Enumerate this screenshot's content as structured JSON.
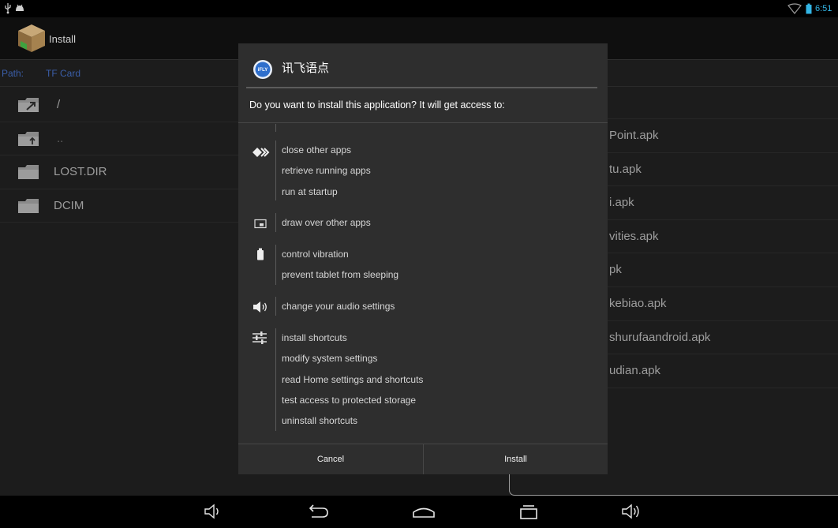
{
  "status_bar": {
    "time": "6:51",
    "left_icons": [
      "usb-icon",
      "android-debug-icon"
    ],
    "right_icons": [
      "wifi-icon",
      "battery-icon"
    ]
  },
  "app_bar": {
    "title": "Install",
    "icon": "installer-app-icon"
  },
  "path_bar": {
    "label": "Path:",
    "value": "TF Card"
  },
  "left_pane": {
    "items": [
      {
        "label": "/",
        "icon": "folder-root-icon"
      },
      {
        "label": "..",
        "icon": "folder-up-icon"
      },
      {
        "label": "LOST.DIR",
        "icon": "folder-icon"
      },
      {
        "label": "DCIM",
        "icon": "folder-icon"
      }
    ]
  },
  "right_pane": {
    "items": [
      {
        "label": "Point.apk"
      },
      {
        "label": "tu.apk"
      },
      {
        "label": "i.apk"
      },
      {
        "label": "vities.apk"
      },
      {
        "label": "pk"
      },
      {
        "label": "kebiao.apk"
      },
      {
        "label": "shurufaandroid.apk"
      },
      {
        "label": "udian.apk"
      }
    ]
  },
  "dialog": {
    "app_icon": "ifly-app-icon",
    "app_icon_text": "iFLY",
    "app_name": "讯飞语点",
    "message": "Do you want to install this application? It will get access to:",
    "permission_groups": [
      {
        "icon": "app-info-icon",
        "items": [
          "close other apps",
          "retrieve running apps",
          "run at startup"
        ]
      },
      {
        "icon": "window-icon",
        "items": [
          "draw over other apps"
        ]
      },
      {
        "icon": "battery-icon",
        "items": [
          "control vibration",
          "prevent tablet from sleeping"
        ]
      },
      {
        "icon": "speaker-icon",
        "items": [
          "change your audio settings"
        ]
      },
      {
        "icon": "sliders-icon",
        "items": [
          "install shortcuts",
          "modify system settings",
          "read Home settings and shortcuts",
          "test access to protected storage",
          "uninstall shortcuts"
        ]
      }
    ],
    "cancel_label": "Cancel",
    "install_label": "Install"
  },
  "nav_bar": {
    "icons": [
      "volume-down-icon",
      "back-icon",
      "home-icon",
      "recents-icon",
      "volume-up-icon"
    ]
  },
  "colors": {
    "accent": "#33b5e5",
    "path_text": "#3b5ea8",
    "background": "#1c1c1c",
    "dialog_background": "#2e2e2e"
  }
}
